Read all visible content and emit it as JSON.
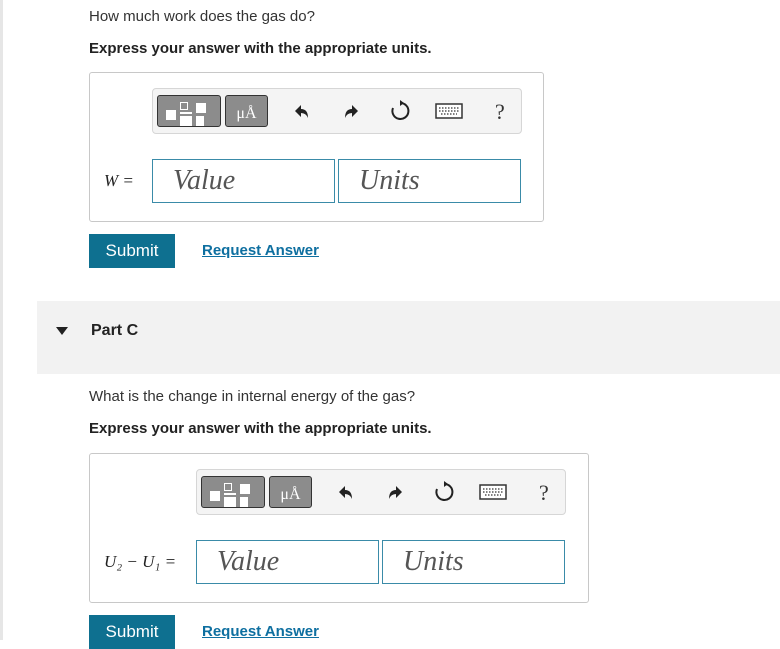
{
  "partB": {
    "question": "How much work does the gas do?",
    "instruction": "Express your answer with the appropriate units.",
    "variable_label": "W =",
    "value_placeholder": "Value",
    "units_placeholder": "Units",
    "submit_label": "Submit",
    "request_label": "Request Answer"
  },
  "partC": {
    "header": "Part C",
    "question": "What is the change in internal energy of the gas?",
    "instruction": "Express your answer with the appropriate units.",
    "variable_label": "U₂ − U₁ =",
    "value_placeholder": "Value",
    "units_placeholder": "Units",
    "submit_label": "Submit",
    "request_label": "Request Answer"
  },
  "toolbar": {
    "units_glyph": "μÅ",
    "help_glyph": "?",
    "icons": [
      "fraction-templates-icon",
      "units-icon",
      "undo-icon",
      "redo-icon",
      "reset-icon",
      "keyboard-icon",
      "help-icon"
    ]
  },
  "colors": {
    "accent": "#0e7090",
    "link": "#0e6fa0",
    "field_border": "#3a8ba8"
  }
}
